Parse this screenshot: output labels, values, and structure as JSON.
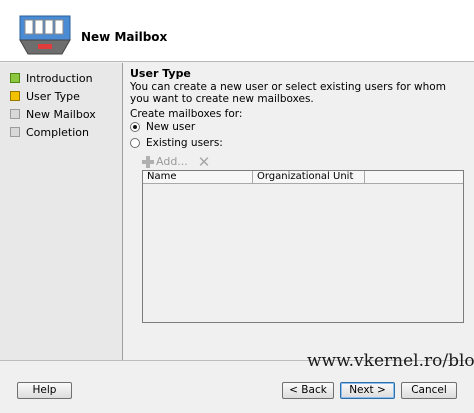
{
  "header": {
    "title": "New Mailbox",
    "icon": "mailbox-wizard-icon"
  },
  "sidebar": {
    "steps": [
      {
        "label": "Introduction",
        "state": "done"
      },
      {
        "label": "User Type",
        "state": "current"
      },
      {
        "label": "New Mailbox",
        "state": "pending"
      },
      {
        "label": "Completion",
        "state": "pending"
      }
    ]
  },
  "main": {
    "section_title": "User Type",
    "description": "You can create a new user or select existing users for whom you want to create new mailboxes.",
    "mailboxes_label": "Create mailboxes for:",
    "options": [
      {
        "label": "New user",
        "selected": true
      },
      {
        "label": "Existing users:",
        "selected": false
      }
    ],
    "toolbar": {
      "add_label": "Add...",
      "remove_icon": "remove-x-icon"
    },
    "grid": {
      "columns": [
        "Name",
        "Organizational Unit",
        ""
      ]
    }
  },
  "footer": {
    "watermark": "www.vkernel.ro/blog",
    "help": "Help",
    "back": "< Back",
    "next": "Next >",
    "cancel": "Cancel"
  },
  "colors": {
    "done": "#8dc63f",
    "current": "#f2c200",
    "pending": "#d8d8d8"
  }
}
